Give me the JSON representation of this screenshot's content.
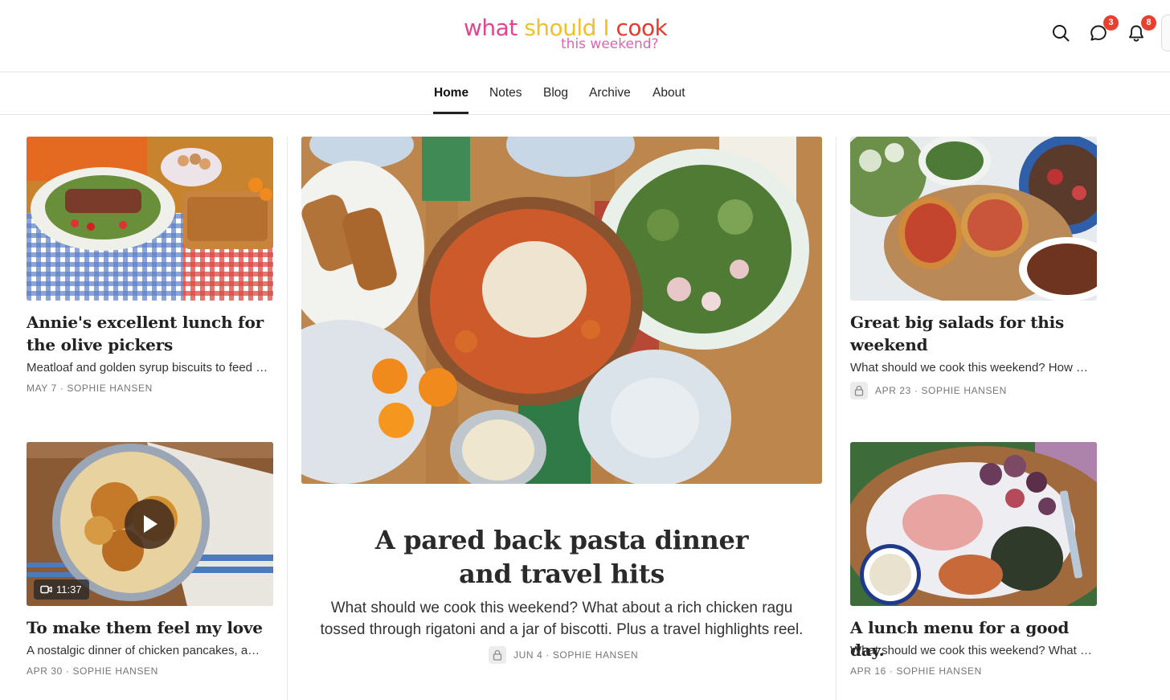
{
  "header": {
    "logo_line1_a": "what ",
    "logo_line1_b": "should I",
    "logo_line1_c": " cook",
    "logo_line2": "this weekend?",
    "chat_badge": "3",
    "notification_badge": "8",
    "colors": {
      "pink": "#e0468f",
      "yellow": "#f0bf2e",
      "red": "#e23a2c",
      "light_pink": "#d766b3",
      "badge": "#e8402f"
    }
  },
  "nav": {
    "items": [
      {
        "label": "Home"
      },
      {
        "label": "Notes"
      },
      {
        "label": "Blog"
      },
      {
        "label": "Archive"
      },
      {
        "label": "About"
      }
    ],
    "active": "Home"
  },
  "posts": {
    "left_top": {
      "title": "Annie's excellent lunch for the olive pickers",
      "subtitle": "Meatloaf and golden syrup biscuits to feed a crowd",
      "date": "MAY 7",
      "author": "SOPHIE HANSEN"
    },
    "left_bottom": {
      "title": "To make them feel my love",
      "subtitle": "A nostalgic dinner of chicken pancakes, and more",
      "date": "APR 30",
      "author": "SOPHIE HANSEN",
      "video_duration": "11:37"
    },
    "featured": {
      "title": "A pared back pasta dinner and travel hits",
      "subtitle": "What should we cook this weekend? What about a rich chicken ragu tossed through rigatoni and a jar of biscotti. Plus a travel highlights reel.",
      "date": "JUN 4",
      "author": "SOPHIE HANSEN",
      "locked": true
    },
    "right_top": {
      "title": "Great big salads for this weekend",
      "subtitle": "What should we cook this weekend? How about great big salads",
      "date": "APR 23",
      "author": "SOPHIE HANSEN",
      "locked": true
    },
    "right_bottom": {
      "title": "A lunch menu for a good day.",
      "subtitle": "What should we cook this weekend? What about a lunch menu",
      "date": "APR 16",
      "author": "SOPHIE HANSEN"
    }
  },
  "separator": " · "
}
